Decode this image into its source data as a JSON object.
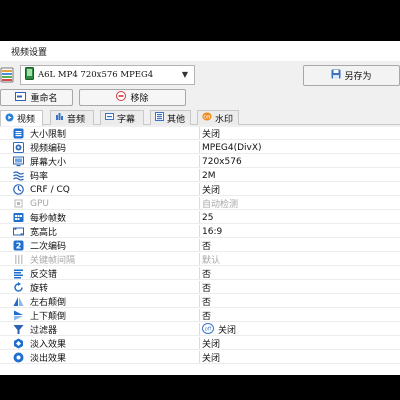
{
  "window": {
    "title": "视频设置"
  },
  "preset": {
    "value": "A6L MP4 720x576 MPEG4",
    "save_as_label": "另存为"
  },
  "buttons": {
    "rename_label": "重命名",
    "remove_label": "移除"
  },
  "tabs": [
    {
      "label": "视频",
      "active": true
    },
    {
      "label": "音频",
      "active": false
    },
    {
      "label": "字幕",
      "active": false
    },
    {
      "label": "其他",
      "active": false
    },
    {
      "label": "水印",
      "active": false
    }
  ],
  "rows": [
    {
      "key": "大小限制",
      "value": "关闭",
      "icon": "size-limit-icon",
      "color": "#1e6fd0",
      "disabled": false
    },
    {
      "key": "视频编码",
      "value": "MPEG4(DivX)",
      "icon": "video-codec-icon",
      "color": "#2f6bbb",
      "disabled": false
    },
    {
      "key": "屏幕大小",
      "value": "720x576",
      "icon": "monitor-icon",
      "color": "#2a63b6",
      "disabled": false
    },
    {
      "key": "码率",
      "value": "2M",
      "icon": "bitrate-icon",
      "color": "#2a63b6",
      "disabled": false
    },
    {
      "key": "CRF / CQ",
      "value": "关闭",
      "icon": "crf-icon",
      "color": "#2a63b6",
      "disabled": false
    },
    {
      "key": "GPU",
      "value": "自动检测",
      "icon": "gpu-icon",
      "color": "#b8b8b8",
      "disabled": true
    },
    {
      "key": "每秒帧数",
      "value": "25",
      "icon": "fps-icon",
      "color": "#1e6fd0",
      "disabled": false
    },
    {
      "key": "宽高比",
      "value": "16:9",
      "icon": "aspect-ratio-icon",
      "color": "#2a63b6",
      "disabled": false
    },
    {
      "key": "二次编码",
      "value": "否",
      "icon": "two-pass-icon",
      "color": "#1e6fd0",
      "disabled": false
    },
    {
      "key": "关键帧间隔",
      "value": "默认",
      "icon": "keyframe-icon",
      "color": "#b8b8b8",
      "disabled": true
    },
    {
      "key": "反交错",
      "value": "否",
      "icon": "deinterlace-icon",
      "color": "#1e6fd0",
      "disabled": false
    },
    {
      "key": "旋转",
      "value": "否",
      "icon": "rotate-icon",
      "color": "#1e6fd0",
      "disabled": false
    },
    {
      "key": "左右颠倒",
      "value": "否",
      "icon": "flip-horizontal-icon",
      "color": "#1e6fd0",
      "disabled": false
    },
    {
      "key": "上下颠倒",
      "value": "否",
      "icon": "flip-vertical-icon",
      "color": "#1e6fd0",
      "disabled": false
    },
    {
      "key": "过滤器",
      "value": "关闭",
      "icon": "filter-icon",
      "color": "#2a63b6",
      "disabled": false,
      "value_icon": "off-toggle-icon"
    },
    {
      "key": "淡入效果",
      "value": "关闭",
      "icon": "fade-in-icon",
      "color": "#1e6fd0",
      "disabled": false
    },
    {
      "key": "淡出效果",
      "value": "关闭",
      "icon": "fade-out-icon",
      "color": "#1e6fd0",
      "disabled": false
    }
  ]
}
